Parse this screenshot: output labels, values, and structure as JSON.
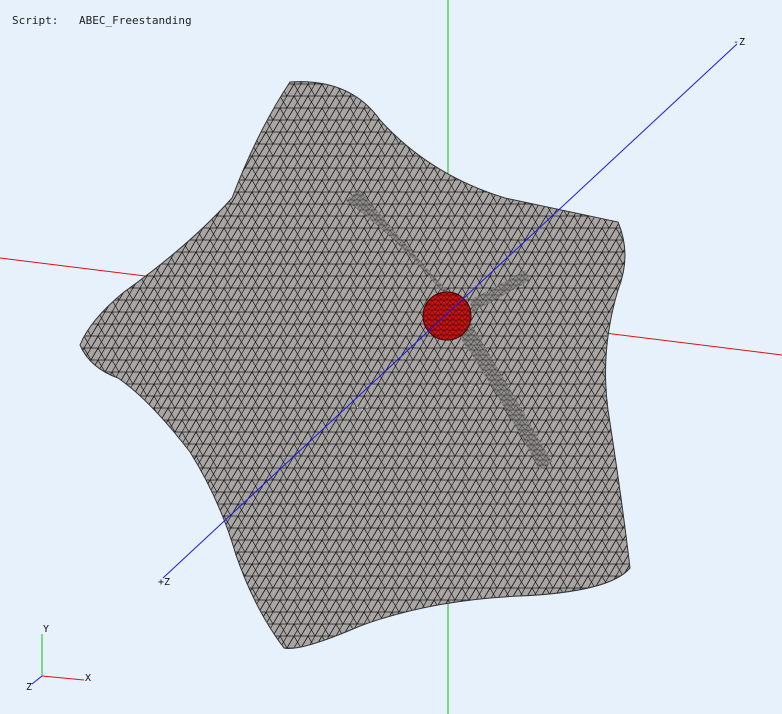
{
  "header": {
    "script_label": "Script:",
    "script_name": "ABEC_Freestanding"
  },
  "axes": {
    "minus_z": "-Z",
    "plus_z": "+Z"
  },
  "triad": {
    "x": "X",
    "y": "Y",
    "z": "Z"
  },
  "colors": {
    "background": "#e6f1fb",
    "mesh_fill": "#a8a5a2",
    "mesh_lines": "#1a1a1a",
    "driver_fill": "#c81414",
    "axis_red": "#e01010",
    "axis_green": "#10c010",
    "axis_blue": "#1a1ae8"
  }
}
